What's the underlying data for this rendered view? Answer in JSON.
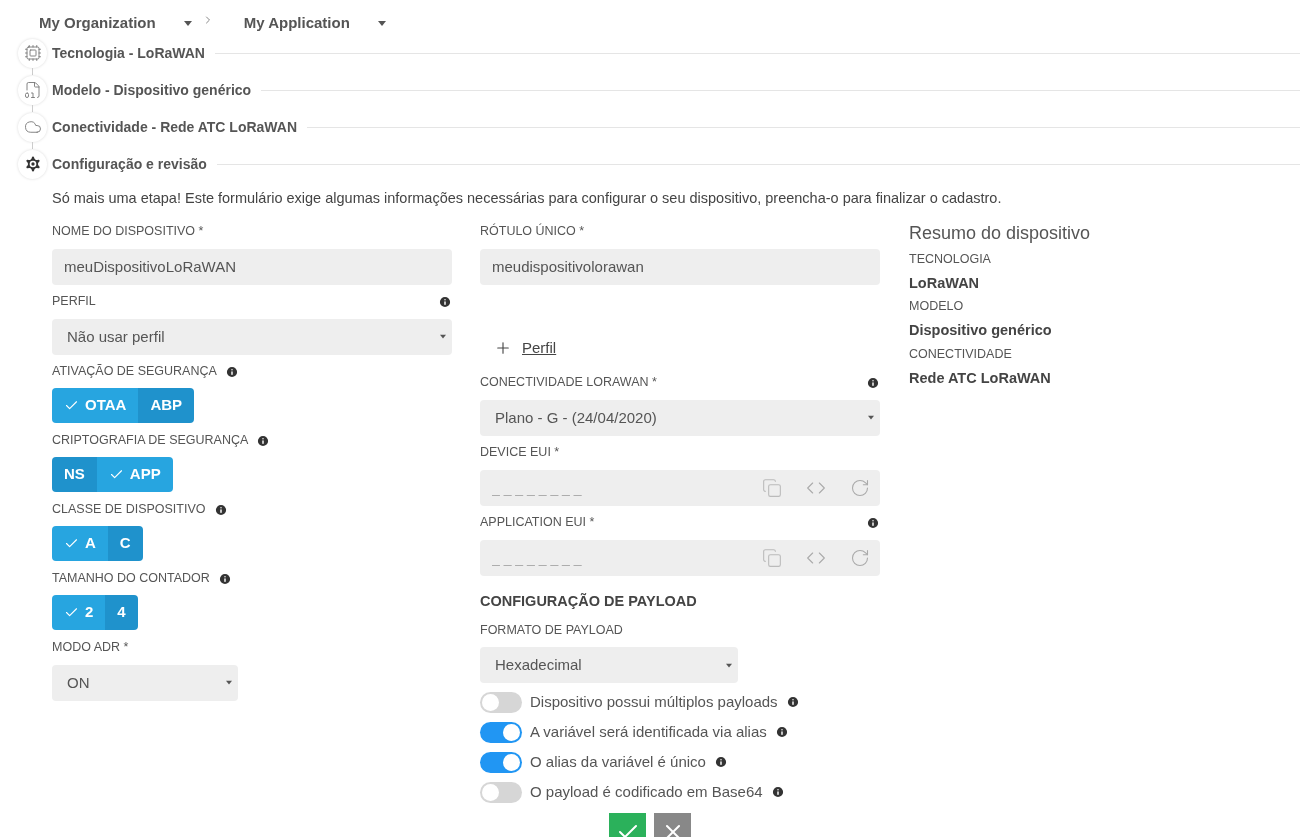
{
  "breadcrumb": [
    {
      "label": "My Organization"
    },
    {
      "label": "My Application"
    }
  ],
  "steps": [
    {
      "kind": "chip",
      "label": "Tecnologia - LoRaWAN"
    },
    {
      "kind": "file",
      "label": "Modelo - Dispositivo genérico"
    },
    {
      "kind": "cloud",
      "label": "Conectividade - Rede ATC LoRaWAN"
    },
    {
      "kind": "gear",
      "label": "Configuração e revisão"
    }
  ],
  "intro": "Só mais uma etapa! Este formulário exige algumas informações necessárias para configurar o seu dispositivo, preencha-o para finalizar o cadastro.",
  "left_fields": [
    {
      "kind": "input",
      "label": "NOME DO DISPOSITIVO *",
      "value": "meuDispositivoLoRaWAN",
      "info": false
    },
    {
      "kind": "select",
      "label": "PERFIL",
      "value": "Não usar perfil",
      "info": true
    },
    {
      "kind": "segmented",
      "label": "ATIVAÇÃO DE SEGURANÇA",
      "info": true,
      "options": [
        {
          "label": "OTAA",
          "selected": true
        },
        {
          "label": "ABP",
          "selected": false
        }
      ]
    },
    {
      "kind": "segmented",
      "label": "CRIPTOGRAFIA DE SEGURANÇA",
      "info": true,
      "options": [
        {
          "label": "NS",
          "selected": false
        },
        {
          "label": "APP",
          "selected": true
        }
      ]
    },
    {
      "kind": "segmented",
      "label": "CLASSE DE DISPOSITIVO",
      "info": true,
      "options": [
        {
          "label": "A",
          "selected": true
        },
        {
          "label": "C",
          "selected": false
        }
      ]
    },
    {
      "kind": "segmented",
      "label": "TAMANHO DO CONTADOR",
      "info": true,
      "options": [
        {
          "label": "2",
          "selected": true
        },
        {
          "label": "4",
          "selected": false
        }
      ]
    },
    {
      "kind": "compact_select",
      "label": "MODO ADR *",
      "value": "ON",
      "info": false
    }
  ],
  "right_fields": [
    {
      "kind": "input",
      "label": "RÓTULO ÚNICO *",
      "value": "meudispositivolorawan",
      "info": false
    },
    {
      "kind": "add_link",
      "label": "Perfil"
    },
    {
      "kind": "select",
      "label": "CONECTIVIDADE LORAWAN *",
      "value": "Plano - G - (24/04/2020)",
      "info": true
    },
    {
      "kind": "eui",
      "label": "DEVICE EUI *",
      "placeholder": "_ _ _ _ _ _ _ _",
      "info": false
    },
    {
      "kind": "eui",
      "label": "APPLICATION EUI *",
      "placeholder": "_ _ _ _ _ _ _ _",
      "info": true
    }
  ],
  "payload": {
    "title": "CONFIGURAÇÃO DE PAYLOAD",
    "format_label": "FORMATO DE PAYLOAD",
    "format_value": "Hexadecimal",
    "toggles": [
      {
        "label": "Dispositivo possui múltiplos payloads",
        "on": false
      },
      {
        "label": "A variável será identificada via alias",
        "on": true
      },
      {
        "label": "O alias da variável é único",
        "on": true
      },
      {
        "label": "O payload é codificado em Base64",
        "on": false
      }
    ]
  },
  "summary": {
    "title": "Resumo do dispositivo",
    "items": [
      {
        "label": "TECNOLOGIA",
        "value": "LoRaWAN"
      },
      {
        "label": "MODELO",
        "value": "Dispositivo genérico"
      },
      {
        "label": "CONECTIVIDADE",
        "value": "Rede ATC LoRaWAN"
      }
    ]
  }
}
